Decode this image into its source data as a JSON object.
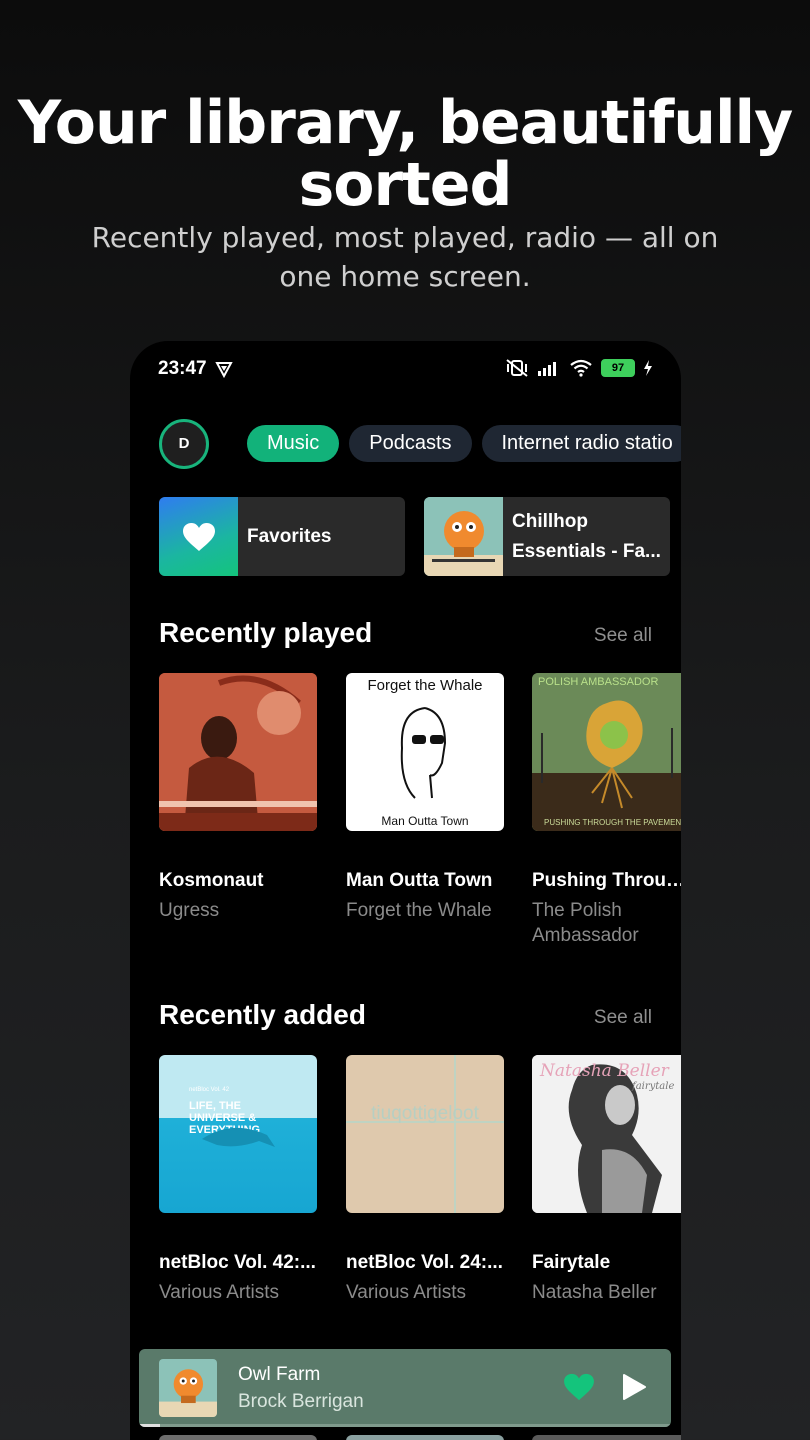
{
  "promo": {
    "headline": "Your library, beautifully sorted",
    "subhead": "Recently played, most played, radio — all on one home screen."
  },
  "statusbar": {
    "time": "23:47",
    "battery": "97"
  },
  "profile": {
    "initial": "D"
  },
  "chips": [
    "Music",
    "Podcasts",
    "Internet radio statio"
  ],
  "shortcuts": [
    {
      "label": "Favorites"
    },
    {
      "label": "Chillhop Essentials - Fa..."
    }
  ],
  "recently_played": {
    "title": "Recently played",
    "see_all": "See all",
    "items": [
      {
        "title": "Kosmonaut",
        "subtitle": "Ugress"
      },
      {
        "title": "Man Outta Town",
        "subtitle": "Forget the Whale",
        "art_top": "Forget the Whale",
        "art_bottom": "Man Outta Town"
      },
      {
        "title": "Pushing Throug...",
        "subtitle": "The Polish Ambassador",
        "art_top": "POLISH AMBASSADOR",
        "art_bottom": "PUSHING THROUGH THE PAVEMENT"
      }
    ]
  },
  "recently_added": {
    "title": "Recently added",
    "see_all": "See all",
    "items": [
      {
        "title": "netBloc Vol. 42:...",
        "subtitle": "Various Artists",
        "art_text": "LIFE, THE UNIVERSE & EVERYTHING",
        "art_small": "netBloc Vol. 42"
      },
      {
        "title": "netBloc Vol. 24:...",
        "subtitle": "Various Artists",
        "art_text": "tiuqottigeloot"
      },
      {
        "title": "Fairytale",
        "subtitle": "Natasha Beller",
        "art_text": "Natasha Beller",
        "art_small": "fairytale"
      }
    ]
  },
  "now_playing": {
    "title": "Owl Farm",
    "artist": "Brock Berrigan",
    "progress": 0.04
  },
  "colors": {
    "accent": "#12b27a",
    "chip_bg": "#1f2733",
    "mini_player": "#5a7a6a"
  }
}
